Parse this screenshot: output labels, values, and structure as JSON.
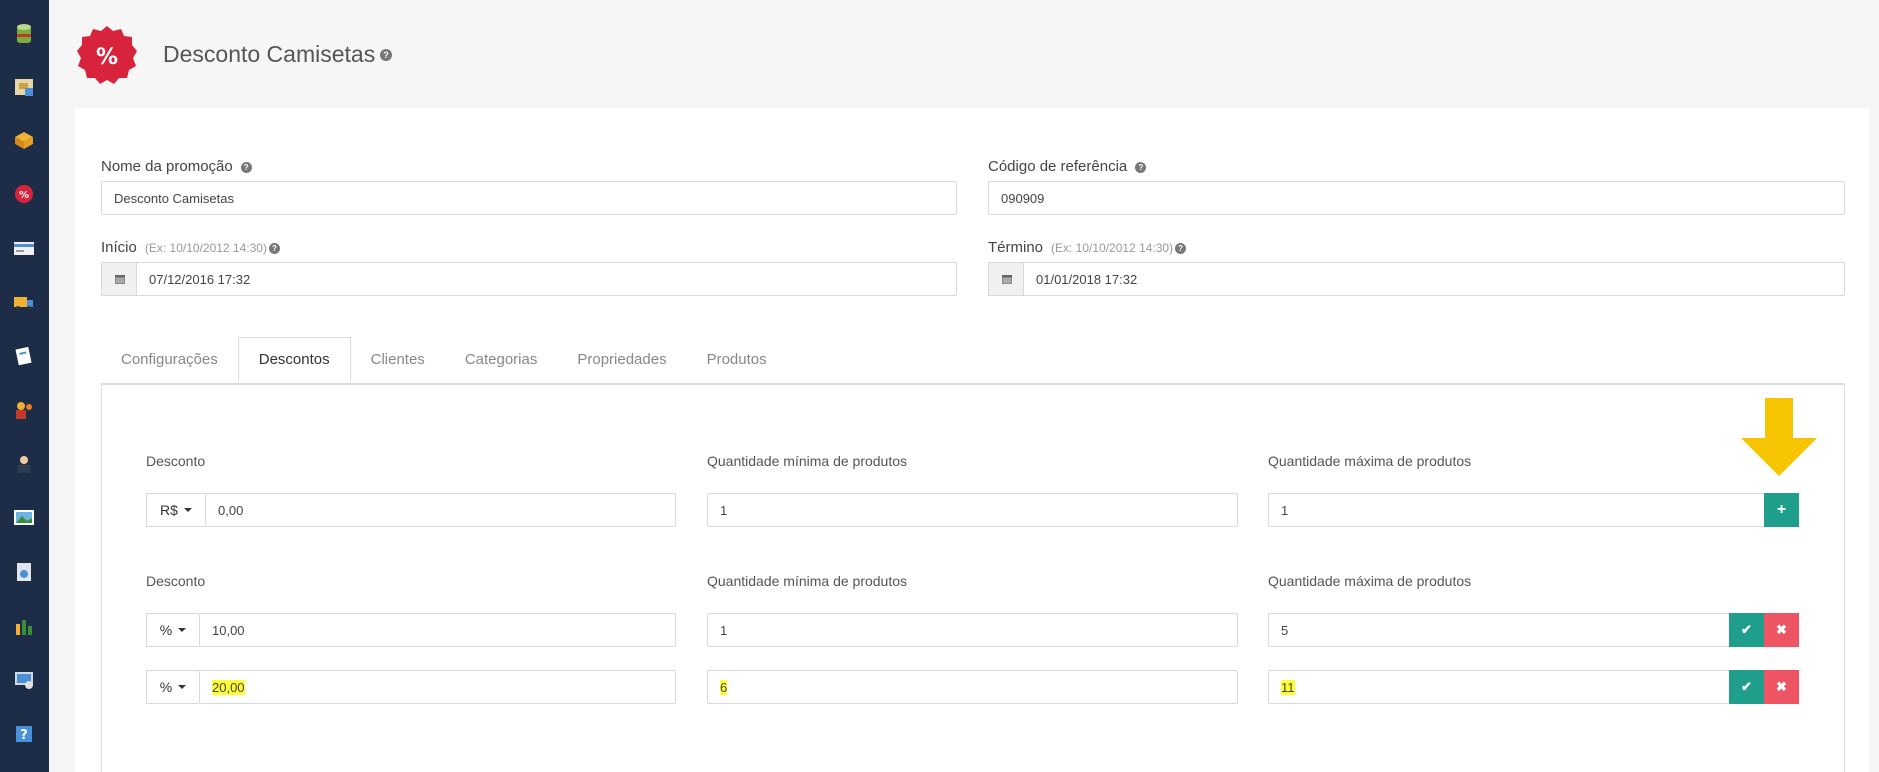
{
  "header": {
    "title": "Desconto Camisetas",
    "help": "?",
    "badge_symbol": "%"
  },
  "form": {
    "promo_name": {
      "label": "Nome da promoção",
      "value": "Desconto Camisetas"
    },
    "ref_code": {
      "label": "Código de referência",
      "value": "090909"
    },
    "start": {
      "label": "Início",
      "hint": "(Ex: 10/10/2012 14:30)",
      "value": "07/12/2016 17:32"
    },
    "end": {
      "label": "Término",
      "hint": "(Ex: 10/10/2012 14:30)",
      "value": "01/01/2018 17:32"
    }
  },
  "tabs": [
    {
      "label": "Configurações"
    },
    {
      "label": "Descontos"
    },
    {
      "label": "Clientes"
    },
    {
      "label": "Categorias"
    },
    {
      "label": "Propriedades"
    },
    {
      "label": "Produtos"
    }
  ],
  "discounts": {
    "col_discount": "Desconto",
    "col_min": "Quantidade mínima de produtos",
    "col_max": "Quantidade máxima de produtos",
    "new_row": {
      "unit": "R$",
      "value": "0,00",
      "min": "1",
      "max": "1",
      "add_symbol": "+"
    },
    "rows": [
      {
        "unit": "%",
        "value": "10,00",
        "min": "1",
        "max": "5"
      },
      {
        "unit": "%",
        "value": "20,00",
        "min": "6",
        "max": "11"
      }
    ],
    "confirm_symbol": "✔",
    "delete_symbol": "✖"
  },
  "colors": {
    "accent": "#1f9e8b",
    "danger": "#ed5565",
    "sidebar": "#1d2c47",
    "badge": "#d8233c",
    "arrow": "#f6c400",
    "highlight": "#ffff33"
  }
}
